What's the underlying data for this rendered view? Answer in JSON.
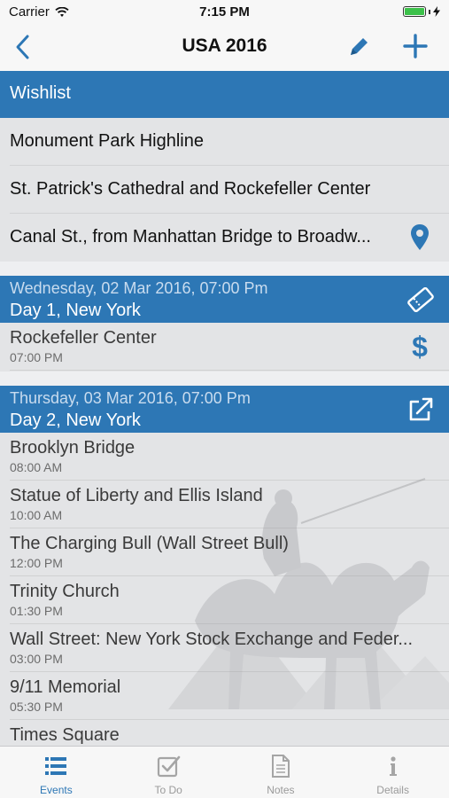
{
  "status_bar": {
    "carrier": "Carrier",
    "time": "7:15 PM"
  },
  "nav": {
    "title": "USA 2016"
  },
  "wishlist": {
    "header": "Wishlist",
    "items": [
      "Monument Park Highline",
      "St. Patrick's Cathedral and Rockefeller Center",
      "Canal St., from Manhattan Bridge to Broadw..."
    ]
  },
  "days": [
    {
      "date": "Wednesday, 02 Mar 2016, 07:00 Pm",
      "title": "Day 1, New York",
      "icon": "ticket-icon",
      "events": [
        {
          "name": "Rockefeller Center",
          "time": "07:00 PM",
          "icon": "dollar-icon"
        }
      ]
    },
    {
      "date": "Thursday, 03 Mar 2016, 07:00 Pm",
      "title": "Day 2, New York",
      "icon": "external-link-icon",
      "events": [
        {
          "name": "Brooklyn Bridge",
          "time": "08:00 AM"
        },
        {
          "name": "Statue of Liberty and Ellis Island",
          "time": "10:00 AM"
        },
        {
          "name": "The Charging Bull (Wall Street Bull)",
          "time": "12:00 PM"
        },
        {
          "name": "Trinity Church",
          "time": "01:30 PM"
        },
        {
          "name": "Wall Street: New York Stock Exchange and Feder...",
          "time": "03:00 PM"
        },
        {
          "name": "9/11 Memorial",
          "time": "05:30 PM"
        },
        {
          "name": "Times Square",
          "time": ""
        }
      ]
    }
  ],
  "tabs": [
    {
      "label": "Events",
      "icon": "list-icon",
      "active": true
    },
    {
      "label": "To Do",
      "icon": "checkbox-icon",
      "active": false
    },
    {
      "label": "Notes",
      "icon": "document-icon",
      "active": false
    },
    {
      "label": "Details",
      "icon": "info-icon",
      "active": false
    }
  ],
  "colors": {
    "accent": "#2d77b5",
    "background": "#e3e4e6",
    "tab_inactive": "#9a9a9a"
  }
}
